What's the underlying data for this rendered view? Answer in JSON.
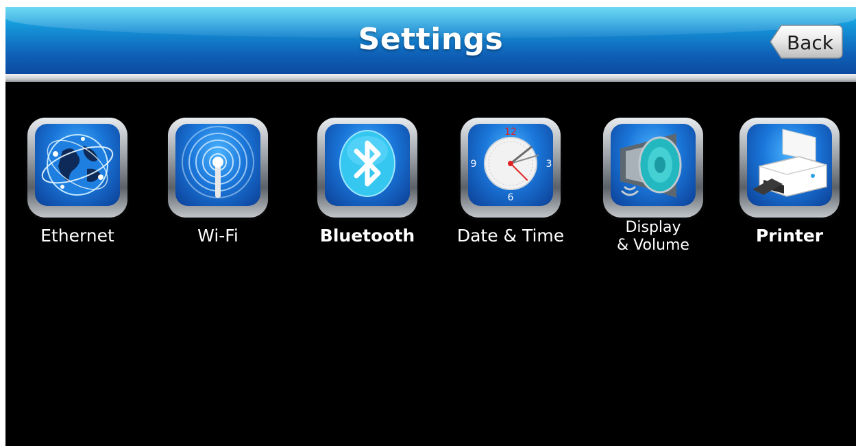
{
  "header": {
    "title": "Settings",
    "back_label": "Back"
  },
  "tiles": [
    {
      "label": "Ethernet",
      "icon": "globe-icon"
    },
    {
      "label": "Wi-Fi",
      "icon": "wifi-antenna-icon"
    },
    {
      "label": "Bluetooth",
      "icon": "bluetooth-icon"
    },
    {
      "label": "Date & Time",
      "icon": "clock-icon",
      "clock_numbers": [
        "12",
        "3",
        "6",
        "9"
      ]
    },
    {
      "label_line1": "Display",
      "label_line2": "& Volume",
      "icon": "speaker-icon"
    },
    {
      "label": "Printer",
      "icon": "printer-icon"
    }
  ],
  "colors": {
    "header_top": "#1fc4ee",
    "header_bottom": "#0b4aa0",
    "background": "#000000",
    "tile_inner": "#1a76d9"
  }
}
